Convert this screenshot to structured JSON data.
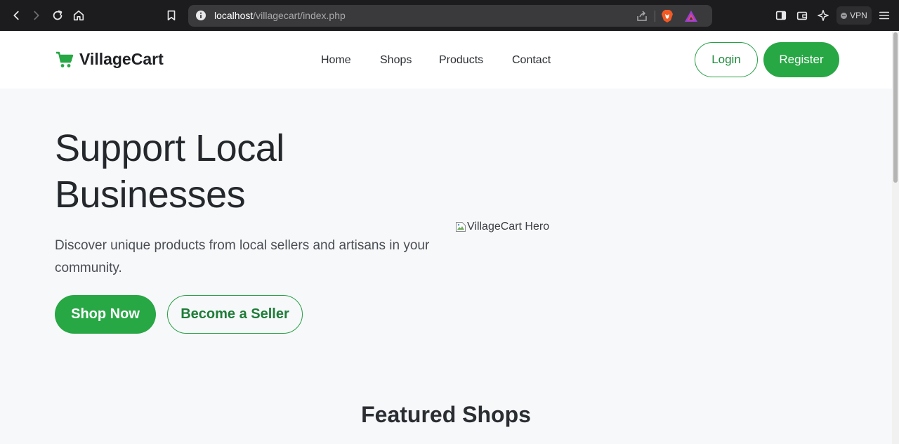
{
  "browser": {
    "url_host": "localhost",
    "url_path": "/villagecart/index.php",
    "vpn_label": "VPN"
  },
  "site": {
    "brand": "VillageCart",
    "nav": [
      {
        "label": "Home"
      },
      {
        "label": "Shops"
      },
      {
        "label": "Products"
      },
      {
        "label": "Contact"
      }
    ],
    "login_label": "Login",
    "register_label": "Register"
  },
  "hero": {
    "title_line1": "Support Local",
    "title_line2": "Businesses",
    "subtitle": "Discover unique products from local sellers and artisans in your community.",
    "image_alt": "VillageCart Hero",
    "shop_now_label": "Shop Now",
    "become_seller_label": "Become a Seller"
  },
  "featured": {
    "title": "Featured Shops"
  },
  "colors": {
    "accent": "#28a745",
    "chrome_bg": "#1c1c1e",
    "page_bg": "#f7f8fa"
  }
}
